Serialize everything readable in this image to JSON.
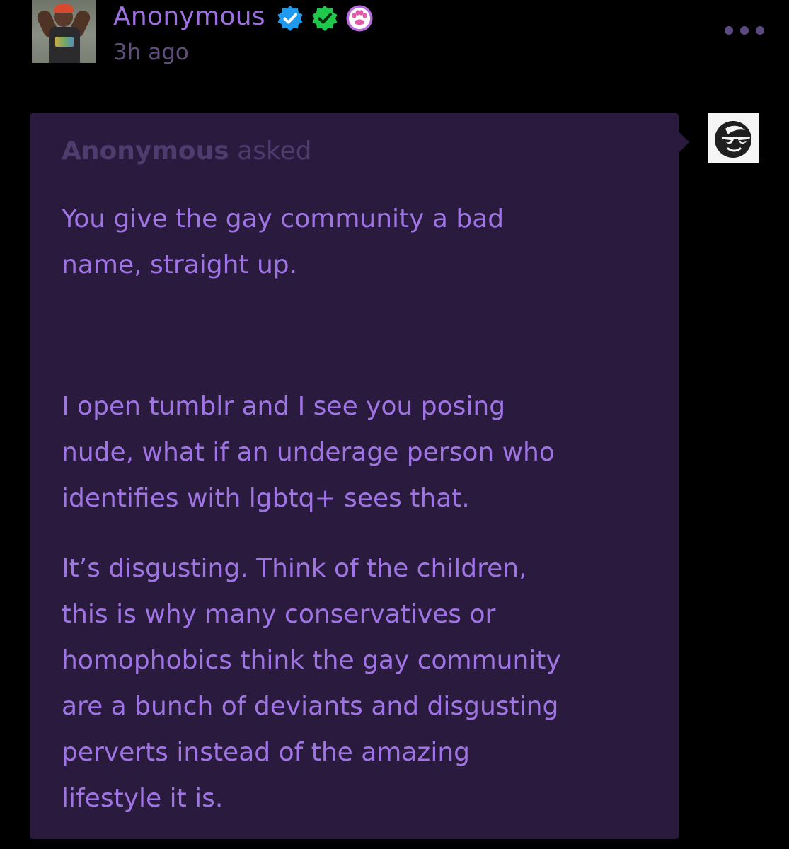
{
  "post": {
    "author": "Anonymous",
    "timestamp": "3h ago",
    "badges": [
      "verified-blue-badge-icon",
      "verified-green-badge-icon",
      "paw-badge-icon"
    ]
  },
  "ask": {
    "asker_name": "Anonymous",
    "asked_label": "asked",
    "paragraphs": [
      "You give the gay community a bad\nname, straight up.",
      "I open tumblr and I see you posing\nnude, what if an underage person who\nidentifies with lgbtq+ sees that.",
      "It’s disgusting. Think of the children,\nthis is why many conservatives or\nhomophobics think the gay community\nare a bunch of deviants and disgusting\nperverts instead of the amazing\nlifestyle it is."
    ]
  },
  "colors": {
    "background": "#000000",
    "bubble": "#2a1a3d",
    "text": "#9f74e4",
    "muted": "#4f3b6d",
    "username": "#9d6fe0"
  }
}
